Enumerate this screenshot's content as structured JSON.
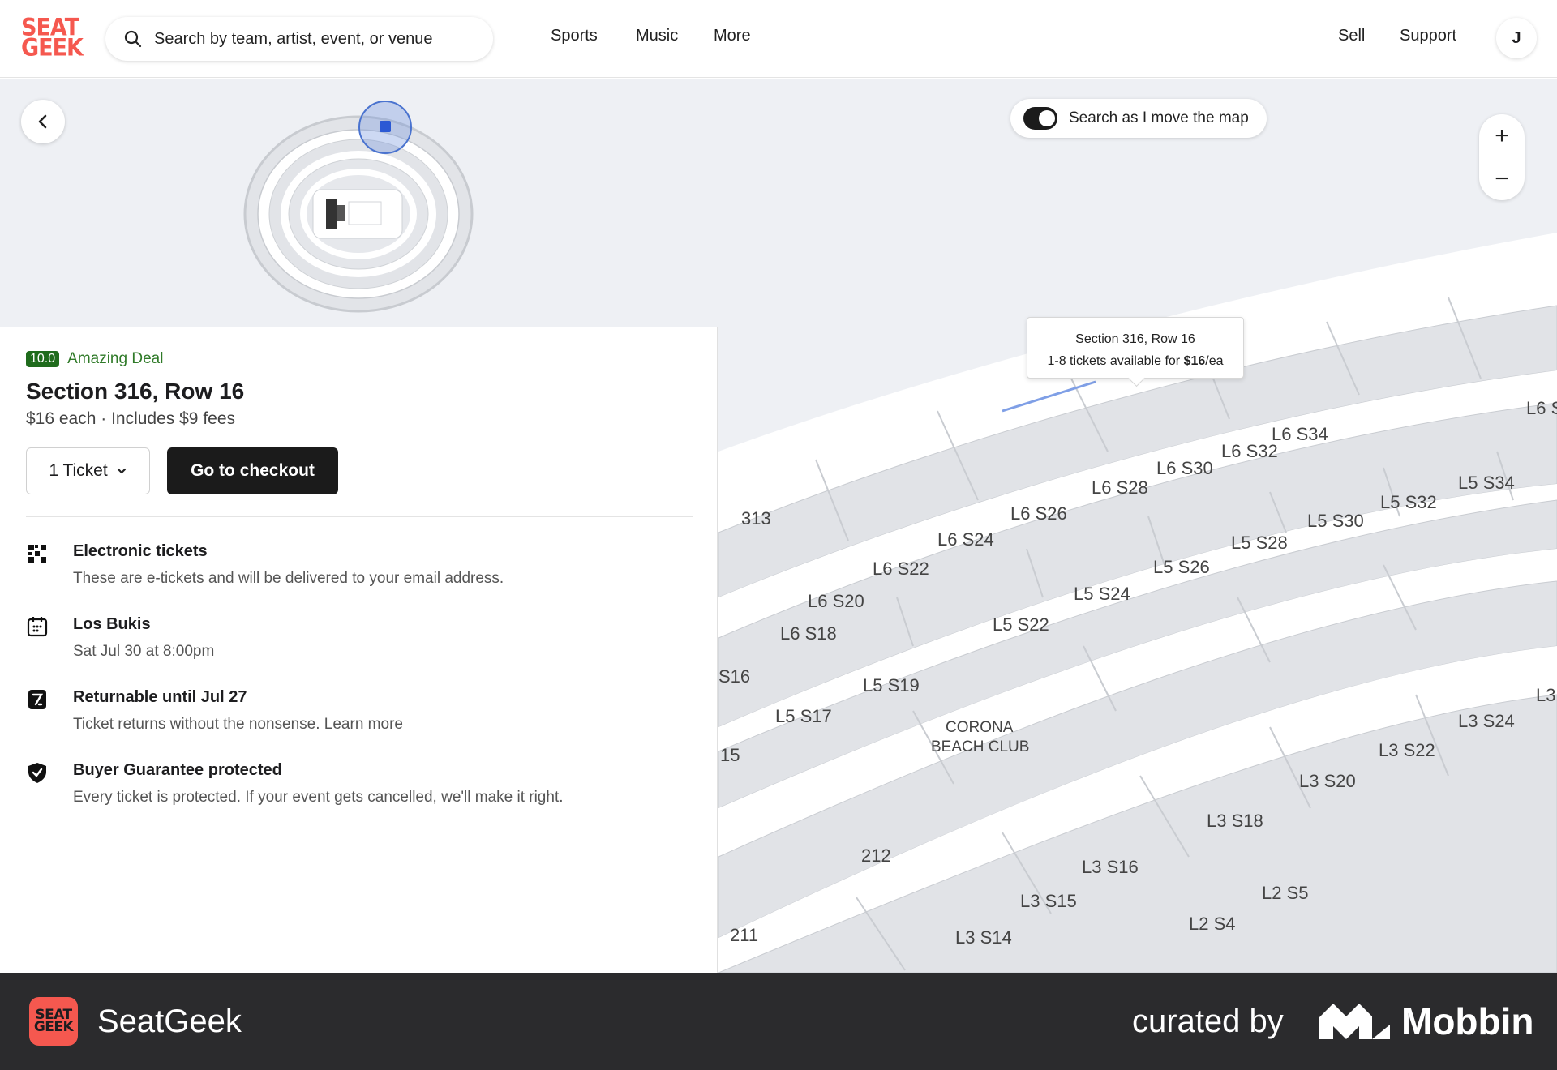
{
  "header": {
    "logo_line1": "SEAT",
    "logo_line2": "GEEK",
    "search_placeholder": "Search by team, artist, event, or venue",
    "nav": [
      "Sports",
      "Music",
      "More"
    ],
    "sell": "Sell",
    "support": "Support",
    "avatar_initial": "J"
  },
  "listing": {
    "deal_score": "10.0",
    "deal_label": "Amazing Deal",
    "title": "Section 316, Row 16",
    "price_line": "$16 each · Includes $9 fees",
    "quantity": "1 Ticket",
    "checkout": "Go to checkout"
  },
  "features": [
    {
      "icon": "qr-code-icon",
      "title": "Electronic tickets",
      "desc": "These are e-tickets and will be delivered to your email address."
    },
    {
      "icon": "calendar-icon",
      "title": "Los Bukis",
      "desc": "Sat Jul 30 at 8:00pm"
    },
    {
      "icon": "return-icon",
      "title": "Returnable until Jul 27",
      "desc": "Ticket returns without the nonsense.",
      "link": "Learn more"
    },
    {
      "icon": "shield-check-icon",
      "title": "Buyer Guarantee protected",
      "desc": "Every ticket is protected. If your event gets cancelled, we'll make it right."
    }
  ],
  "map": {
    "toggle_label": "Search as I move the map",
    "zoom_in": "+",
    "zoom_out": "−",
    "tooltip_line1": "Section 316, Row 16",
    "tooltip_line2_prefix": "1-8 tickets available for ",
    "tooltip_price": "$16",
    "tooltip_suffix": "/ea",
    "labels": [
      "313",
      "L6 S34",
      "L6 S32",
      "L6 S30",
      "L6 S28",
      "L6 S26",
      "L6 S24",
      "L6 S22",
      "L6 S20",
      "L6 S18",
      "S16",
      "L5 S34",
      "L5 S32",
      "L5 S30",
      "L5 S28",
      "L5 S26",
      "L5 S24",
      "L5 S22",
      "L5 S19",
      "L5 S17",
      "15",
      "CORONA",
      "BEACH CLUB",
      "L3 S24",
      "L3 S22",
      "L3 S20",
      "L3 S18",
      "L3 S16",
      "L3 S15",
      "L3 S14",
      "L2 S5",
      "L2 S4",
      "212",
      "211",
      "L6 S",
      "L3"
    ]
  },
  "footer": {
    "logo_line1": "SEAT",
    "logo_line2": "GEEK",
    "app_name": "SeatGeek",
    "curated_by": "curated by",
    "brand": "Mobbin"
  }
}
